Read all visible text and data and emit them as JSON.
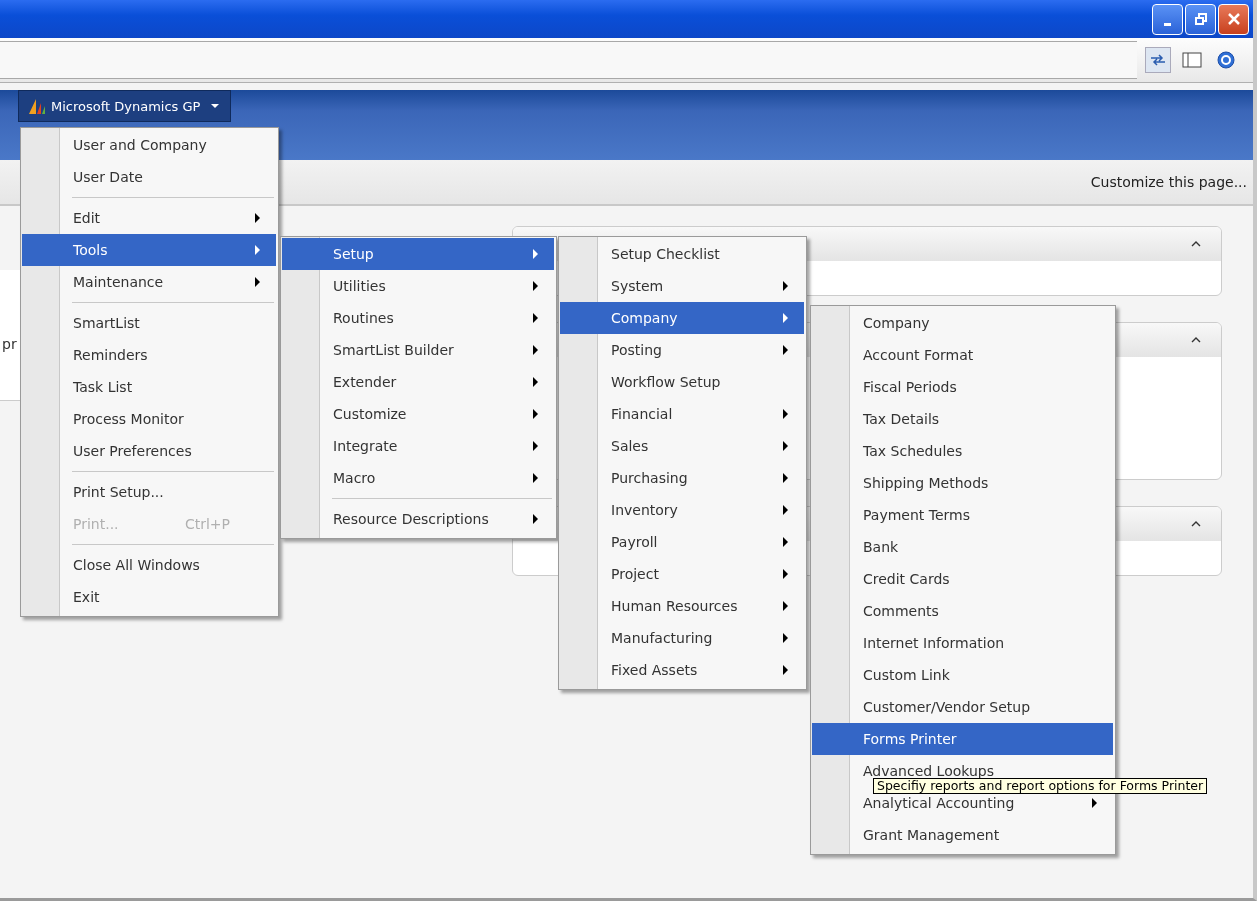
{
  "nav": {
    "button": "Microsoft Dynamics GP"
  },
  "page_header": {
    "link": "Customize this page..."
  },
  "left_panel": {
    "text": "pr"
  },
  "panels": [
    {
      "collapsed": false
    },
    {
      "collapsed": false
    },
    {
      "collapsed": false
    }
  ],
  "menus": [
    {
      "items": [
        {
          "kind": "item",
          "label": "User and Company",
          "has_submenu": false,
          "selected": false,
          "disabled": false
        },
        {
          "kind": "item",
          "label": "User Date",
          "has_submenu": false,
          "selected": false,
          "disabled": false
        },
        {
          "kind": "separator"
        },
        {
          "kind": "item",
          "label": "Edit",
          "has_submenu": true,
          "selected": false,
          "disabled": false
        },
        {
          "kind": "item",
          "label": "Tools",
          "has_submenu": true,
          "selected": true,
          "disabled": false
        },
        {
          "kind": "item",
          "label": "Maintenance",
          "has_submenu": true,
          "selected": false,
          "disabled": false
        },
        {
          "kind": "separator"
        },
        {
          "kind": "item",
          "label": "SmartList",
          "has_submenu": false,
          "selected": false,
          "disabled": false
        },
        {
          "kind": "item",
          "label": "Reminders",
          "has_submenu": false,
          "selected": false,
          "disabled": false
        },
        {
          "kind": "item",
          "label": "Task List",
          "has_submenu": false,
          "selected": false,
          "disabled": false
        },
        {
          "kind": "item",
          "label": "Process Monitor",
          "has_submenu": false,
          "selected": false,
          "disabled": false
        },
        {
          "kind": "item",
          "label": "User Preferences",
          "has_submenu": false,
          "selected": false,
          "disabled": false
        },
        {
          "kind": "separator"
        },
        {
          "kind": "item",
          "label": "Print Setup...",
          "has_submenu": false,
          "selected": false,
          "disabled": false
        },
        {
          "kind": "item",
          "label": "Print...",
          "shortcut": "Ctrl+P",
          "has_submenu": false,
          "selected": false,
          "disabled": true
        },
        {
          "kind": "separator"
        },
        {
          "kind": "item",
          "label": "Close All Windows",
          "has_submenu": false,
          "selected": false,
          "disabled": false
        },
        {
          "kind": "item",
          "label": "Exit",
          "has_submenu": false,
          "selected": false,
          "disabled": false
        }
      ]
    },
    {
      "items": [
        {
          "kind": "item",
          "label": "Setup",
          "has_submenu": true,
          "selected": true,
          "disabled": false
        },
        {
          "kind": "item",
          "label": "Utilities",
          "has_submenu": true,
          "selected": false,
          "disabled": false
        },
        {
          "kind": "item",
          "label": "Routines",
          "has_submenu": true,
          "selected": false,
          "disabled": false
        },
        {
          "kind": "item",
          "label": "SmartList Builder",
          "has_submenu": true,
          "selected": false,
          "disabled": false
        },
        {
          "kind": "item",
          "label": "Extender",
          "has_submenu": true,
          "selected": false,
          "disabled": false
        },
        {
          "kind": "item",
          "label": "Customize",
          "has_submenu": true,
          "selected": false,
          "disabled": false
        },
        {
          "kind": "item",
          "label": "Integrate",
          "has_submenu": true,
          "selected": false,
          "disabled": false
        },
        {
          "kind": "item",
          "label": "Macro",
          "has_submenu": true,
          "selected": false,
          "disabled": false
        },
        {
          "kind": "separator"
        },
        {
          "kind": "item",
          "label": "Resource Descriptions",
          "has_submenu": true,
          "selected": false,
          "disabled": false
        }
      ]
    },
    {
      "items": [
        {
          "kind": "item",
          "label": "Setup Checklist",
          "has_submenu": false,
          "selected": false,
          "disabled": false
        },
        {
          "kind": "item",
          "label": "System",
          "has_submenu": true,
          "selected": false,
          "disabled": false
        },
        {
          "kind": "item",
          "label": "Company",
          "has_submenu": true,
          "selected": true,
          "disabled": false
        },
        {
          "kind": "item",
          "label": "Posting",
          "has_submenu": true,
          "selected": false,
          "disabled": false
        },
        {
          "kind": "item",
          "label": "Workflow Setup",
          "has_submenu": false,
          "selected": false,
          "disabled": false
        },
        {
          "kind": "item",
          "label": "Financial",
          "has_submenu": true,
          "selected": false,
          "disabled": false
        },
        {
          "kind": "item",
          "label": "Sales",
          "has_submenu": true,
          "selected": false,
          "disabled": false
        },
        {
          "kind": "item",
          "label": "Purchasing",
          "has_submenu": true,
          "selected": false,
          "disabled": false
        },
        {
          "kind": "item",
          "label": "Inventory",
          "has_submenu": true,
          "selected": false,
          "disabled": false
        },
        {
          "kind": "item",
          "label": "Payroll",
          "has_submenu": true,
          "selected": false,
          "disabled": false
        },
        {
          "kind": "item",
          "label": "Project",
          "has_submenu": true,
          "selected": false,
          "disabled": false
        },
        {
          "kind": "item",
          "label": "Human Resources",
          "has_submenu": true,
          "selected": false,
          "disabled": false
        },
        {
          "kind": "item",
          "label": "Manufacturing",
          "has_submenu": true,
          "selected": false,
          "disabled": false
        },
        {
          "kind": "item",
          "label": "Fixed Assets",
          "has_submenu": true,
          "selected": false,
          "disabled": false
        }
      ]
    },
    {
      "items": [
        {
          "kind": "item",
          "label": "Company",
          "has_submenu": false,
          "selected": false,
          "disabled": false
        },
        {
          "kind": "item",
          "label": "Account Format",
          "has_submenu": false,
          "selected": false,
          "disabled": false
        },
        {
          "kind": "item",
          "label": "Fiscal Periods",
          "has_submenu": false,
          "selected": false,
          "disabled": false
        },
        {
          "kind": "item",
          "label": "Tax Details",
          "has_submenu": false,
          "selected": false,
          "disabled": false
        },
        {
          "kind": "item",
          "label": "Tax Schedules",
          "has_submenu": false,
          "selected": false,
          "disabled": false
        },
        {
          "kind": "item",
          "label": "Shipping Methods",
          "has_submenu": false,
          "selected": false,
          "disabled": false
        },
        {
          "kind": "item",
          "label": "Payment Terms",
          "has_submenu": false,
          "selected": false,
          "disabled": false
        },
        {
          "kind": "item",
          "label": "Bank",
          "has_submenu": false,
          "selected": false,
          "disabled": false
        },
        {
          "kind": "item",
          "label": "Credit Cards",
          "has_submenu": false,
          "selected": false,
          "disabled": false
        },
        {
          "kind": "item",
          "label": "Comments",
          "has_submenu": false,
          "selected": false,
          "disabled": false
        },
        {
          "kind": "item",
          "label": "Internet Information",
          "has_submenu": false,
          "selected": false,
          "disabled": false
        },
        {
          "kind": "item",
          "label": "Custom Link",
          "has_submenu": false,
          "selected": false,
          "disabled": false
        },
        {
          "kind": "item",
          "label": "Customer/Vendor Setup",
          "has_submenu": false,
          "selected": false,
          "disabled": false
        },
        {
          "kind": "item",
          "label": "Forms Printer",
          "has_submenu": false,
          "selected": true,
          "disabled": false
        },
        {
          "kind": "item",
          "label": "Advanced Lookups",
          "has_submenu": false,
          "selected": false,
          "disabled": false
        },
        {
          "kind": "item",
          "label": "Analytical Accounting",
          "has_submenu": true,
          "selected": false,
          "disabled": false
        },
        {
          "kind": "item",
          "label": "Grant Management",
          "has_submenu": false,
          "selected": false,
          "disabled": false
        }
      ]
    }
  ],
  "tooltip": {
    "text": "Specifiy reports and report options for Forms Printer"
  }
}
